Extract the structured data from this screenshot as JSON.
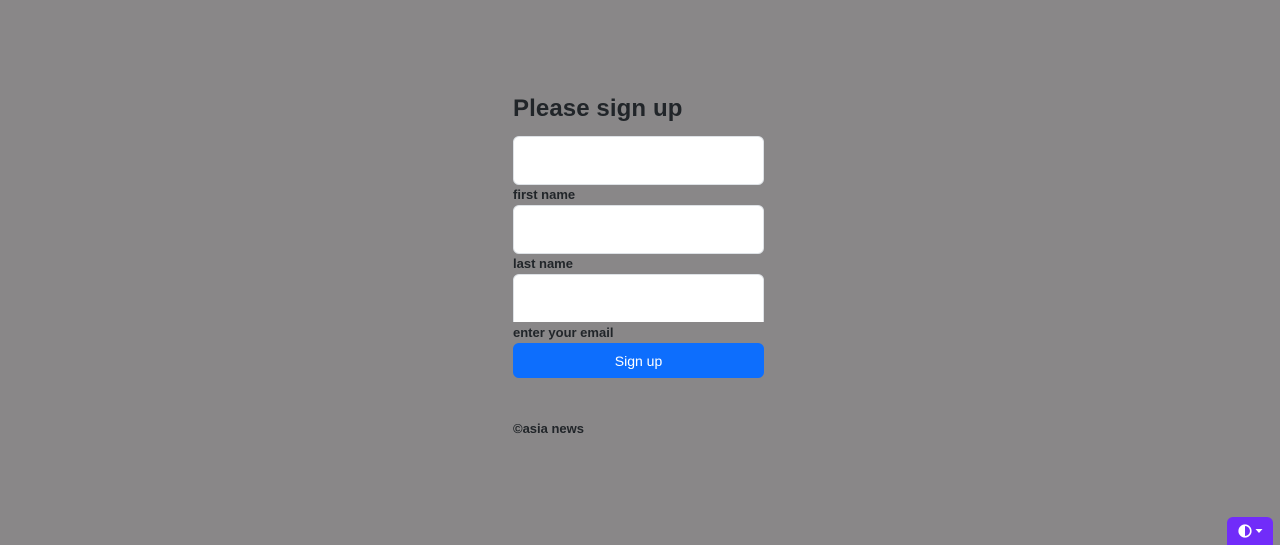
{
  "form": {
    "title": "Please sign up",
    "first_name_value": "",
    "first_name_label": "first name",
    "last_name_value": "",
    "last_name_label": "last name",
    "email_value": "",
    "email_label": "enter your email",
    "submit_label": "Sign up"
  },
  "footer": {
    "copyright": "©asia news"
  },
  "theme_toggle": {
    "icon": "contrast-half-circle-icon",
    "caret_icon": "caret-down-icon",
    "accent": "#712cf9"
  },
  "colors": {
    "background": "#898788",
    "primary": "#0d6efd",
    "text": "#212529"
  }
}
